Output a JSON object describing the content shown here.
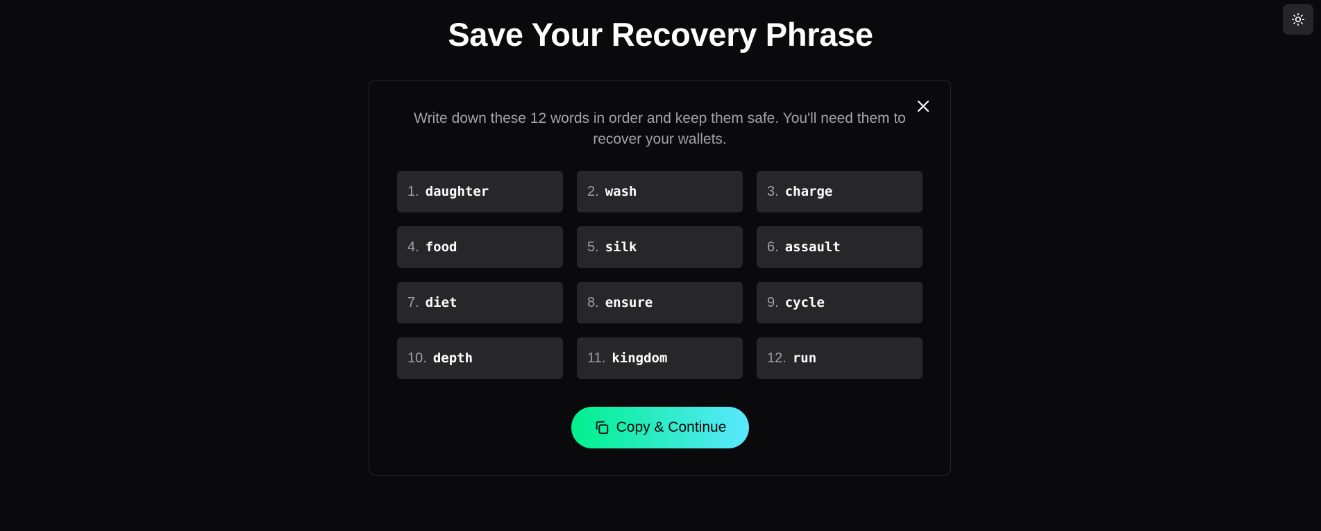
{
  "page": {
    "title": "Save Your Recovery Phrase"
  },
  "theme_toggle": {
    "icon": "sun-icon"
  },
  "dialog": {
    "close_icon": "close-icon",
    "instructions": "Write down these 12 words in order and keep them safe. You'll need them to recover your wallets.",
    "words": [
      {
        "number": "1.",
        "word": "daughter"
      },
      {
        "number": "2.",
        "word": "wash"
      },
      {
        "number": "3.",
        "word": "charge"
      },
      {
        "number": "4.",
        "word": "food"
      },
      {
        "number": "5.",
        "word": "silk"
      },
      {
        "number": "6.",
        "word": "assault"
      },
      {
        "number": "7.",
        "word": "diet"
      },
      {
        "number": "8.",
        "word": "ensure"
      },
      {
        "number": "9.",
        "word": "cycle"
      },
      {
        "number": "10.",
        "word": "depth"
      },
      {
        "number": "11.",
        "word": "kingdom"
      },
      {
        "number": "12.",
        "word": "run"
      }
    ],
    "copy_button": {
      "label": "Copy & Continue",
      "icon": "copy-icon"
    }
  },
  "colors": {
    "background": "#0a0a0c",
    "cell_background": "#27272a",
    "button_gradient_start": "#00f08c",
    "button_gradient_end": "#5ae8ff"
  }
}
